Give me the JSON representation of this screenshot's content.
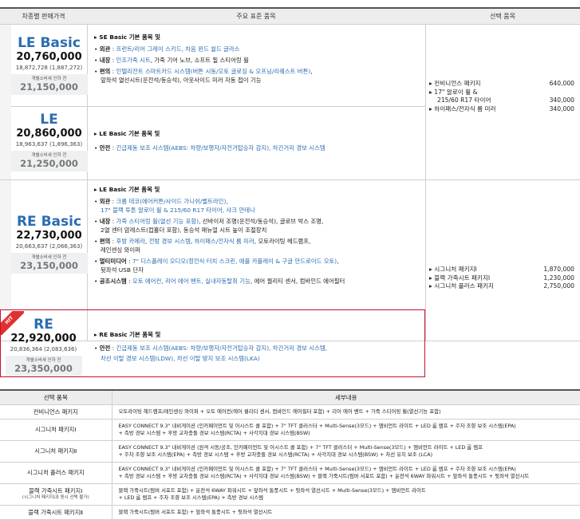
{
  "header": {
    "col1": "차종별 판매가격",
    "col2": "주요 표준 품목",
    "col3": "선택 품목"
  },
  "trims": [
    {
      "name": "LE Basic",
      "price": "20,760,000",
      "sub": "18,872,728 (1,887,272)",
      "box_label": "개별소비세 인하 전",
      "box_value": "21,150,000"
    },
    {
      "name": "LE",
      "price": "20,860,000",
      "sub": "18,963,637 (1,896,363)",
      "box_label": "개별소비세 인하 전",
      "box_value": "21,250,000"
    },
    {
      "name": "RE Basic",
      "price": "22,730,000",
      "sub": "20,663,637 (2,066,363)",
      "box_label": "개별소비세 인하 전",
      "box_value": "23,150,000"
    },
    {
      "name": "RE",
      "price": "22,920,000",
      "sub": "20,836,364 (2,083,636)",
      "box_label": "개별소비세 인하 전",
      "box_value": "23,350,000"
    }
  ],
  "hit_badge": "HIT",
  "features": {
    "le_basic": {
      "title": "SE Basic 기본 품목 및",
      "l1a": "외관",
      "l1b": "프런트/리어 그레이 스키드, 차음 윈드 쉴드 글라스",
      "l2a": "내장",
      "l2b": "인조가죽 시트",
      "l2c": ", 가죽 기어 노브, 소프트 필 스티어링 휠",
      "l3a": "편의",
      "l3b": "인텔리전트 스마트카드 시스템(버튼 시동/오토 글로징 & 오프닝/리퀘스트 버튼)",
      "l3c": ",",
      "l3d": "앞좌석 열선시트(운전석/동승석), 아웃사이드 미러 자동 접이 기능"
    },
    "le": {
      "title": "LE Basic 기본 품목 및",
      "l1a": "안전",
      "l1b": "긴급제동 보조 시스템(AEBS: 차량/보행자/자전거탑승자 감지), 차간거리 경보 시스템"
    },
    "re_basic": {
      "title": "LE Basic 기본 품목 및",
      "l1a": "외관",
      "l1b": "크롬 데코(에어커튼/사이드 가니쉬/벨트라인),",
      "l1c": "17\" 블랙 투톤 알로이 휠 & 215/60 R17 타이어, 샤크 안테나",
      "l2a": "내장",
      "l2b": "가죽 스티어링 휠(열선 기능 포함)",
      "l2c": ", 선바이저 조명(운전석/동승석), 글로브 박스 조명,",
      "l2d": "2열 센터 암레스트(컵홀더 포함), 동승석 매뉴얼 시트 높이 조절장치",
      "l3a": "편의",
      "l3b": "후방 카메라",
      "l3c": ", ",
      "l3d": "전방 경보 시스템",
      "l3e": ", ",
      "l3f": "하이패스/전자식 룸 미러",
      "l3g": ", 오토라이팅 헤드램프,",
      "l3h": "레인센싱 와이퍼",
      "l4a": "멀티미디어",
      "l4b": "7\" 디스플레이 오디오(정전식 터치 스크린, 애플 카플레이 & 구글 안드로이드 오토)",
      "l4c": ",",
      "l4d": "뒷좌석 USB 단자",
      "l5a": "공조시스템",
      "l5b": "오토 에어컨, 리어 에어 벤트, 실내자동탈취 기능",
      "l5c": ", 에어 퀄리티 센서, 컴바인드 에어필터"
    },
    "re": {
      "title": "RE Basic 기본 품목 및",
      "l1a": "안전",
      "l1b": "긴급제동 보조 시스템(AEBS: 차량/보행자/자전거탑승자 감지), 차간거리 경보 시스템,",
      "l1c": "차선 이탈 경보 시스템(LDW), 차선 이탈 방지 보조 시스템(LKA)"
    }
  },
  "options_le": [
    {
      "label": "컨비니언스 패키지",
      "price": "640,000"
    },
    {
      "label": "17\" 알로이 휠 &",
      "price": ""
    },
    {
      "label": "215/60 R17 타이어",
      "price": "340,000"
    },
    {
      "label": "하이패스/전자식 룸 미러",
      "price": "340,000"
    }
  ],
  "options_re": [
    {
      "label": "시그니처 패키지Ⅰ",
      "price": "1,870,000"
    },
    {
      "label": "블랙 가죽시트 패키지Ⅰ",
      "price": "1,230,000"
    },
    {
      "label": "시그니처 플러스 패키지",
      "price": "2,750,000"
    }
  ],
  "table2": {
    "h1": "선택 품목",
    "h2": "세부내용",
    "rows": [
      {
        "name": "컨비니언스 패키지",
        "d1": "오토라이팅 헤드램프/레인센싱 와이퍼 + 오토 에어컨(에어 퀄리티 센서, 컴바인드 에어필터 포함) + 리어 에어 벤트 + 가죽 스티어링 휠(열선기능 포함)",
        "d2": ""
      },
      {
        "name": "시그니처 패키지Ⅰ",
        "d1": "EASY CONNECT 9.3\" 내비게이션 (인카페이먼트 및 어시스트 콜 포함) + 7\" TFT 클러스터 + Multi-Sense(3모드) + 앰비언트 라이트 + LED 룸 램프 + 주차 조향 보조 시스템(EPA)",
        "d2": "+ 측방 경보 시스템 + 후방 교차충돌 경보 시스템(RCTA) + 사각지대 경보 시스템(BSW)"
      },
      {
        "name": "시그니처 패키지Ⅱ",
        "d1": "EASY CONNECT 9.3\" 내비게이션 (원격 시동/공조, 인카페이먼트 및 어시스트 콜 포함) + 7\" TFT 클러스터 + Multi-Sense(3모드) + 앰비언트 라이트 + LED 룸 램프",
        "d2": "+ 주차 조향 보조 시스템(EPA) + 측방 경보 시스템 + 후방 교차충돌 경보 시스템(RCTA) + 사각지대 경보 시스템(BSW) + 차선 유지 보조 (LCA)"
      },
      {
        "name": "시그니처 플러스 패키지",
        "d1": "EASY CONNECT 9.3\" 내비게이션 (인카페이먼트 및 어시스트 콜 포함) + 7\" TFT 클러스터 + Multi-Sense(3모드) + 앰비언트 라이트 + LED 룸 램프 + 주차 조향 보조 시스템(EPA)",
        "d2": "+ 측방 경보 시스템 + 후방 교차충돌 경보 시스템(RCTA) + 사각지대 경보 시스템(BSW) + 블랙 가죽시트(럼버 서포트 포함) + 운전석 6WAY 파워시트 + 앞좌석 통풍시트 + 뒷좌석 열선시트"
      },
      {
        "name": "블랙 가죽시트 패키지Ⅰ",
        "name2": "(시그니처 패키지Ⅰ과 동시 선택 불가)",
        "d1": "블랙 가죽시트(럼버 서포트 포함) + 운전석 6WAY 파워시트 + 앞좌석 통풍시트 + 뒷좌석 열선시트 + Multi-Sense(3모드) + 앰비언트 라이트",
        "d2": "+ LED 룸 램프 + 주차 조향 보조 시스템(EPA) + 측방 경보 시스템"
      },
      {
        "name": "블랙 가죽시트 패키지Ⅱ",
        "d1": "블랙 가죽시트(럼버 서포트 포함) + 앞좌석 통풍시트 + 뒷좌석 열선시트",
        "d2": ""
      }
    ]
  },
  "colors": {
    "accent": "#2b6cb0",
    "hit": "#e0312f",
    "highlight_border": "#c8102e"
  }
}
